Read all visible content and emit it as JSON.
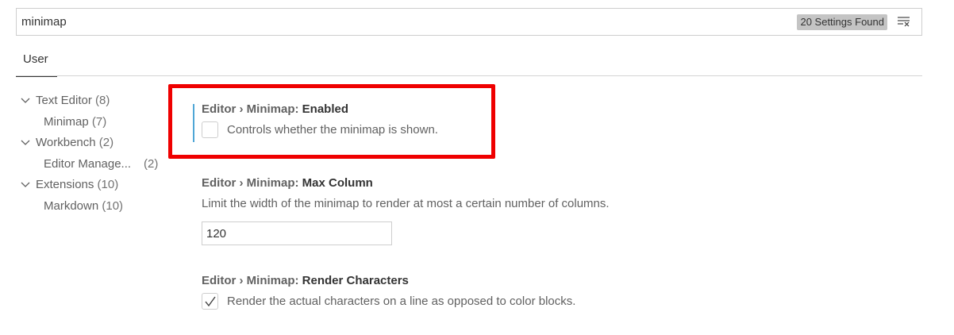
{
  "search": {
    "value": "minimap",
    "results_badge": "20 Settings Found"
  },
  "tabs": [
    {
      "label": "User"
    }
  ],
  "toc": [
    {
      "label": "Text Editor",
      "count": "(8)",
      "expanded": true
    },
    {
      "label": "Minimap",
      "count": "(7)"
    },
    {
      "label": "Workbench",
      "count": "(2)",
      "expanded": true
    },
    {
      "label": "Editor Manage...",
      "count": "(2)"
    },
    {
      "label": "Extensions",
      "count": "(10)",
      "expanded": true
    },
    {
      "label": "Markdown",
      "count": "(10)"
    }
  ],
  "settings": [
    {
      "category": "Editor › Minimap: ",
      "key": "Enabled",
      "description": "Controls whether the minimap is shown.",
      "checked": false
    },
    {
      "category": "Editor › Minimap: ",
      "key": "Max Column",
      "description": "Limit the width of the minimap to render at most a certain number of columns.",
      "value": "120"
    },
    {
      "category": "Editor › Minimap: ",
      "key": "Render Characters",
      "description": "Render the actual characters on a line as opposed to color blocks.",
      "checked": true
    }
  ],
  "colors": {
    "highlight": "#ef0000",
    "focus_bar": "#4fa6d6",
    "badge_bg": "#c4c4c4"
  },
  "icons": {
    "clear": "clear-search-icon",
    "chevron": "chevron-down-icon",
    "check": "checkmark-icon"
  }
}
